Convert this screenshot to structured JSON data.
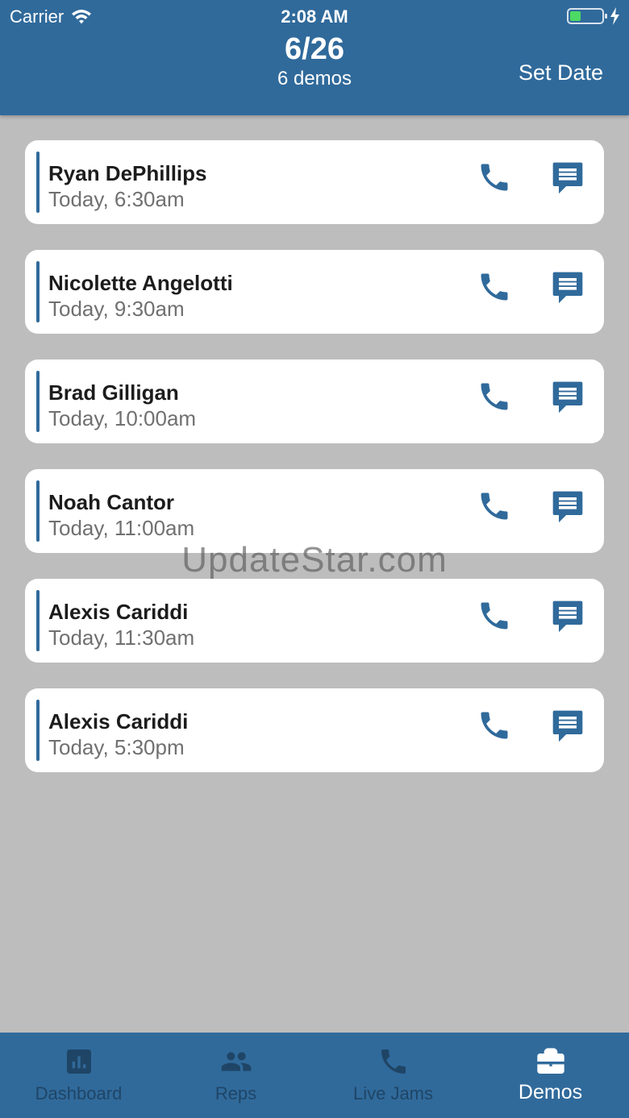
{
  "status_bar": {
    "carrier": "Carrier",
    "time": "2:08 AM"
  },
  "header": {
    "date": "6/26",
    "subtitle": "6 demos",
    "set_date_label": "Set Date"
  },
  "demos": [
    {
      "name": "Ryan DePhillips",
      "time": "Today, 6:30am"
    },
    {
      "name": "Nicolette Angelotti",
      "time": "Today, 9:30am"
    },
    {
      "name": "Brad Gilligan",
      "time": "Today, 10:00am"
    },
    {
      "name": "Noah Cantor",
      "time": "Today, 11:00am"
    },
    {
      "name": "Alexis Cariddi",
      "time": "Today, 11:30am"
    },
    {
      "name": "Alexis Cariddi",
      "time": "Today, 5:30pm"
    }
  ],
  "watermark": "UpdateStar.com",
  "tabs": [
    {
      "label": "Dashboard",
      "icon": "bar-chart-icon",
      "active": false
    },
    {
      "label": "Reps",
      "icon": "people-icon",
      "active": false
    },
    {
      "label": "Live Jams",
      "icon": "phone-icon",
      "active": false
    },
    {
      "label": "Demos",
      "icon": "briefcase-icon",
      "active": true
    }
  ],
  "colors": {
    "primary": "#306a9b",
    "background": "#bdbdbd",
    "tab_inactive": "#1f4566",
    "card": "#ffffff"
  }
}
